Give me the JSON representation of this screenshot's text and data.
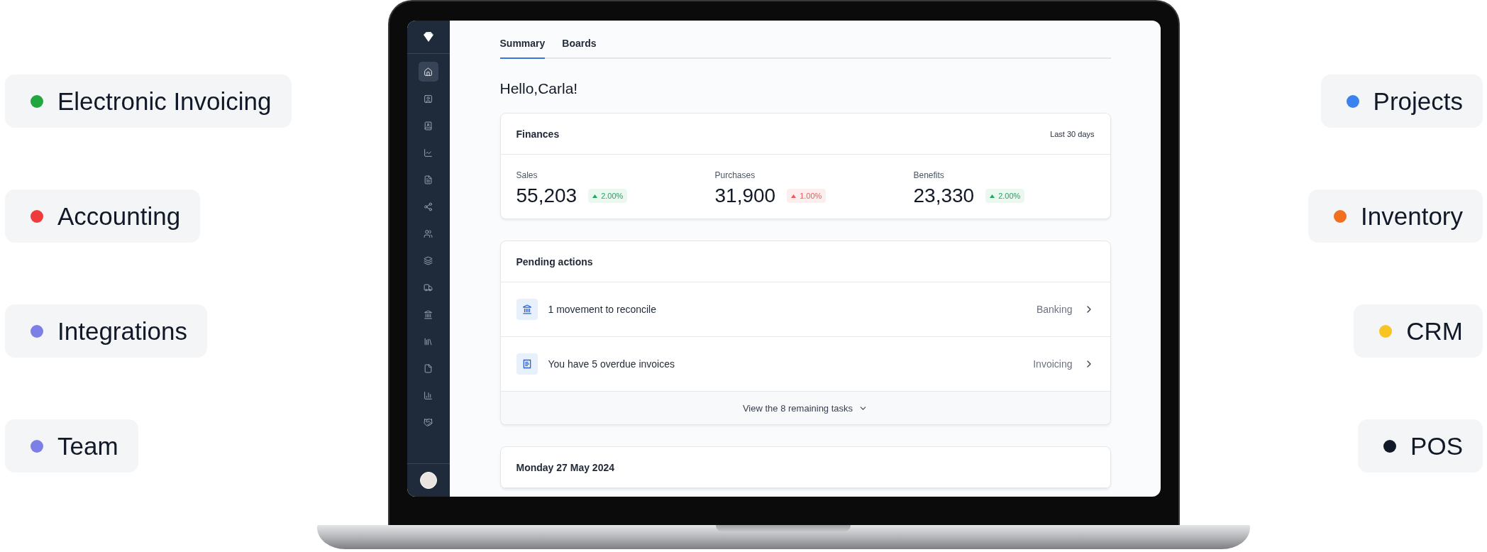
{
  "features_left": [
    {
      "label": "Electronic Invoicing",
      "color": "#22a63e"
    },
    {
      "label": "Accounting",
      "color": "#ef3b3b"
    },
    {
      "label": "Integrations",
      "color": "#7b7fe6"
    },
    {
      "label": "Team",
      "color": "#7b7fe6"
    }
  ],
  "features_right": [
    {
      "label": "Projects",
      "color": "#3b82f0"
    },
    {
      "label": "Inventory",
      "color": "#f07020"
    },
    {
      "label": "CRM",
      "color": "#f8c424"
    },
    {
      "label": "POS",
      "color": "#111827"
    }
  ],
  "sidebar": {
    "items": [
      {
        "selected": true
      },
      {
        "selected": false
      },
      {
        "selected": false
      },
      {
        "selected": false
      },
      {
        "selected": false
      },
      {
        "selected": false
      },
      {
        "selected": false
      },
      {
        "selected": false
      },
      {
        "selected": false
      },
      {
        "selected": false
      },
      {
        "selected": false
      },
      {
        "selected": false
      },
      {
        "selected": false
      },
      {
        "selected": false
      }
    ]
  },
  "tabs": [
    {
      "label": "Summary",
      "selected": true
    },
    {
      "label": "Boards",
      "selected": false
    }
  ],
  "greeting": "Hello,Carla!",
  "finances": {
    "title": "Finances",
    "period": "Last 30 days",
    "stats": [
      {
        "label": "Sales",
        "value": "55,203",
        "change": "2.00%",
        "kind": "positive"
      },
      {
        "label": "Purchases",
        "value": "31,900",
        "change": "1.00%",
        "kind": "negative"
      },
      {
        "label": "Benefits",
        "value": "23,330",
        "change": "2.00%",
        "kind": "positive"
      }
    ]
  },
  "pending": {
    "title": "Pending actions",
    "rows": [
      {
        "text": "1 movement to reconcile",
        "category": "Banking"
      },
      {
        "text": "You have 5 overdue invoices",
        "category": "Invoicing"
      }
    ],
    "footer": "View the 8 remaining tasks"
  },
  "agenda": {
    "title": "Monday 27 May 2024"
  }
}
